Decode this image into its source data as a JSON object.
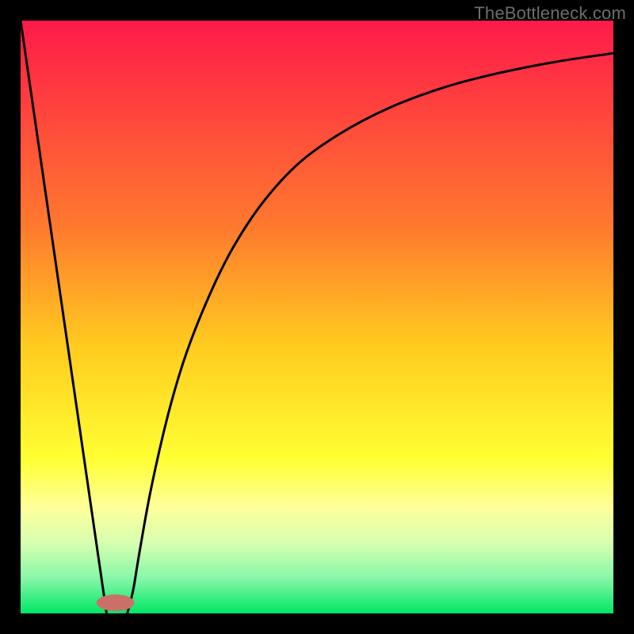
{
  "watermark": "TheBottleneck.com",
  "chart_data": {
    "type": "line",
    "title": "",
    "xlabel": "",
    "ylabel": "",
    "xlim": [
      0,
      100
    ],
    "ylim": [
      0,
      100
    ],
    "background_gradient": {
      "stops": [
        {
          "offset": 0,
          "color": "#ff1a49"
        },
        {
          "offset": 35,
          "color": "#ff7a2e"
        },
        {
          "offset": 55,
          "color": "#ffcc1f"
        },
        {
          "offset": 74,
          "color": "#ffff33"
        },
        {
          "offset": 82,
          "color": "#ffff99"
        },
        {
          "offset": 88,
          "color": "#d8ffb0"
        },
        {
          "offset": 94,
          "color": "#88f7a8"
        },
        {
          "offset": 100,
          "color": "#00e765"
        }
      ]
    },
    "series": [
      {
        "name": "left-branch",
        "color": "#000000",
        "width": 3,
        "x": [
          0.0,
          2.0,
          4.0,
          6.0,
          8.0,
          10.0,
          12.0,
          13.5,
          14.5
        ],
        "y": [
          100.0,
          86.2,
          72.4,
          58.6,
          44.8,
          31.0,
          17.2,
          6.9,
          0.0
        ]
      },
      {
        "name": "right-branch",
        "color": "#000000",
        "width": 3,
        "x": [
          18.0,
          19.0,
          20.0,
          22.0,
          25.0,
          28.0,
          32.0,
          36.0,
          41.0,
          47.0,
          54.0,
          62.0,
          71.0,
          80.0,
          90.0,
          100.0
        ],
        "y": [
          0.0,
          4.0,
          10.0,
          21.0,
          34.0,
          44.0,
          54.0,
          62.0,
          69.5,
          76.0,
          81.0,
          85.2,
          88.6,
          91.0,
          93.0,
          94.5
        ]
      }
    ],
    "marker": {
      "name": "minimum-marker",
      "shape": "capsule",
      "color": "#cb7069",
      "cx": 16.0,
      "cy": 1.8,
      "rx": 3.2,
      "ry": 1.4
    }
  }
}
